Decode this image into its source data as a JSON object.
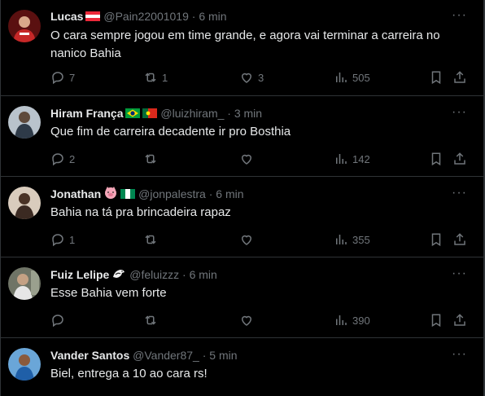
{
  "tweets": [
    {
      "name": "Lucas",
      "flags": [
        "flag-austria"
      ],
      "handle": "@Pain22001019",
      "sep": "·",
      "time": "6 min",
      "text": "O cara sempre jogou em time grande, e agora vai terminar a carreira no nanico Bahia",
      "replies": "7",
      "reposts": "1",
      "likes": "3",
      "views": "505",
      "avatar_color": "#b3261e"
    },
    {
      "name": "Hiram França",
      "flags": [
        "flag-brazil",
        "flag-portugal"
      ],
      "handle": "@luizhiram_",
      "sep": "·",
      "time": "3 min",
      "text": "Que fim de carreira decadente ir pro Bosthia",
      "replies": "2",
      "reposts": "",
      "likes": "",
      "views": "142",
      "avatar_color": "#9aa3ad"
    },
    {
      "name": "Jonathan",
      "flags": [
        "pig-emoji",
        "flag-nigeria"
      ],
      "handle": "@jonpalestra",
      "sep": "·",
      "time": "6 min",
      "text": "Bahia na tá pra brincadeira rapaz",
      "replies": "1",
      "reposts": "",
      "likes": "",
      "views": "355",
      "avatar_color": "#c8b8a8"
    },
    {
      "name": "Fuiz Lelipe",
      "flags": [
        "bird-emoji"
      ],
      "handle": "@feluizzz",
      "sep": "·",
      "time": "6 min",
      "text": "Esse Bahia vem forte",
      "replies": "",
      "reposts": "",
      "likes": "",
      "views": "390",
      "avatar_color": "#8a8f80"
    },
    {
      "name": "Vander Santos",
      "flags": [],
      "handle": "@Vander87_",
      "sep": "·",
      "time": "5 min",
      "text": "Biel, entrega a 10 ao cara rs!",
      "replies": "",
      "reposts": "",
      "likes": "",
      "views": "",
      "avatar_color": "#3a87c8"
    }
  ],
  "colors": {
    "background": "#000000",
    "text": "#e7e9ea",
    "muted": "#71767b",
    "divider": "#2f3336"
  }
}
